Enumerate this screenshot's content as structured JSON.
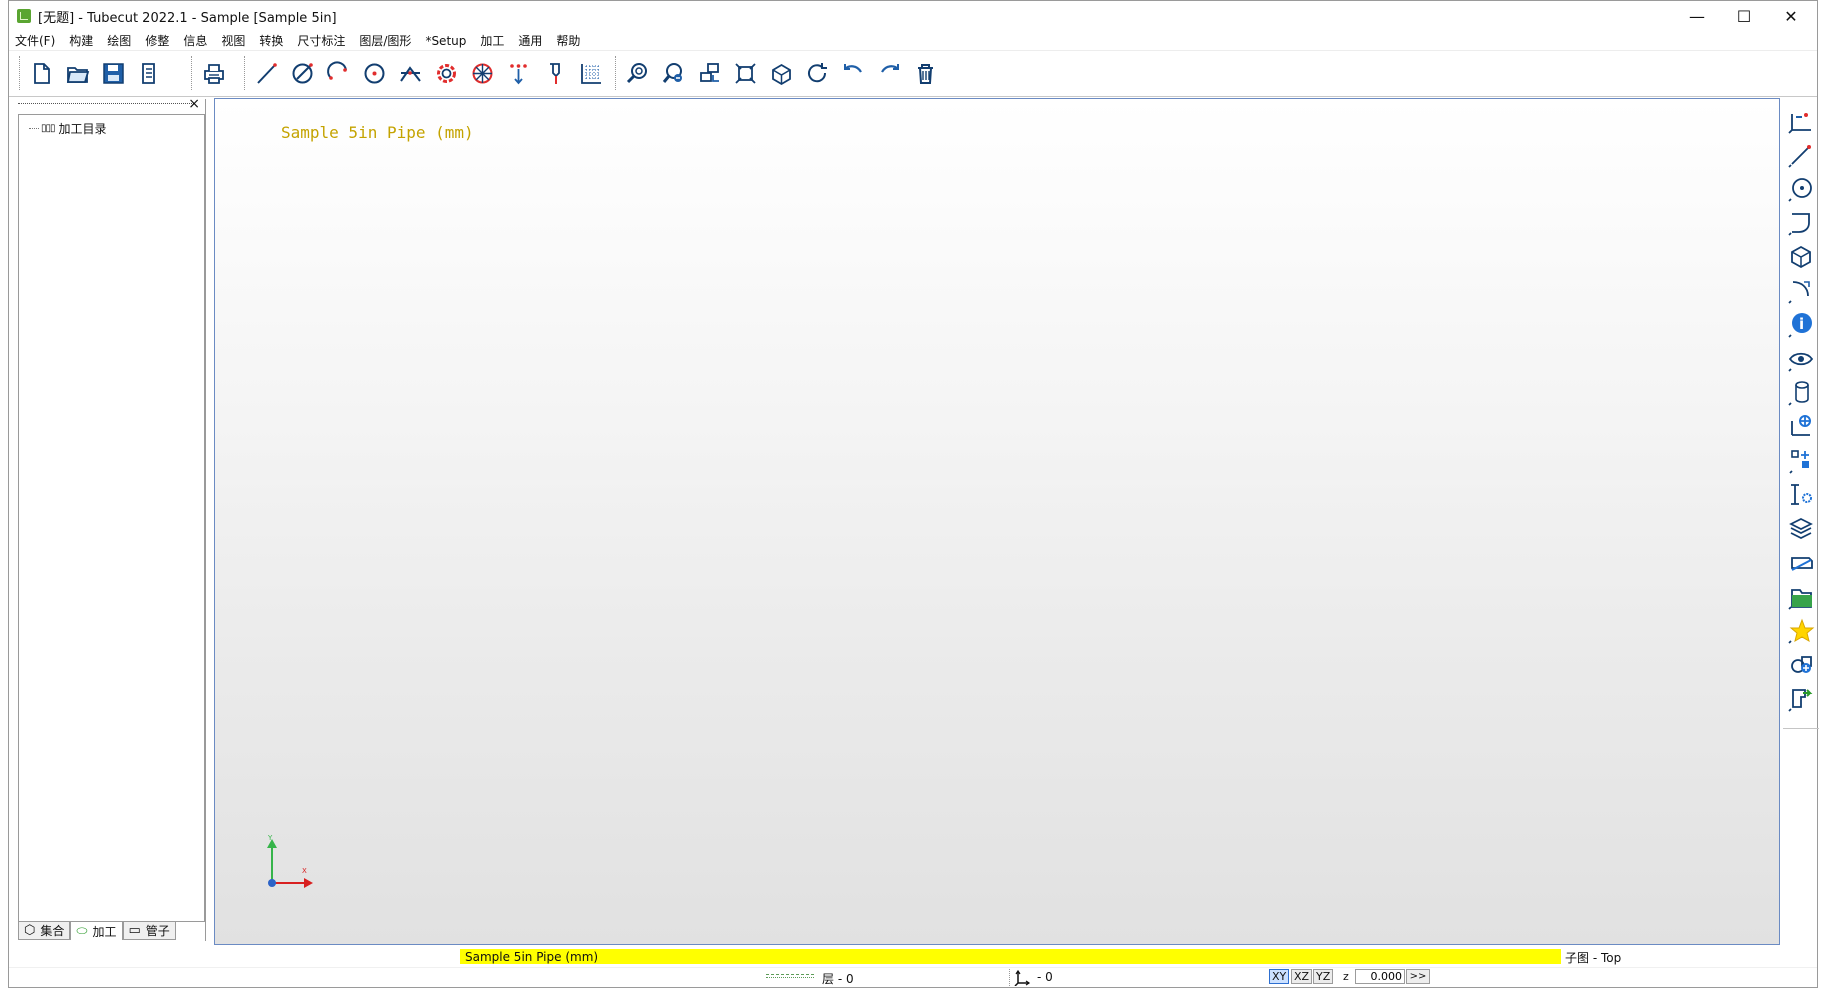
{
  "window": {
    "title": "[无题] - Tubecut 2022.1 - Sample [Sample 5in]",
    "controls": {
      "minimize": "—",
      "maximize": "☐",
      "close": "✕"
    }
  },
  "menu": [
    "文件(F)",
    "构建",
    "绘图",
    "修整",
    "信息",
    "视图",
    "转换",
    "尺寸标注",
    "图层/图形",
    "*Setup",
    "加工",
    "通用",
    "帮助"
  ],
  "toolbar": {
    "icons": [
      "new-file-icon",
      "open-folder-icon",
      "save-icon",
      "document-list-icon",
      "print-icon",
      "line-icon",
      "circle-slash-icon",
      "arc-icon",
      "circle-center-icon",
      "trim-icon",
      "gear-circle-icon",
      "network-icon",
      "array-icon",
      "toolpath-icon",
      "grid-icon",
      "zoom-in-icon",
      "zoom-tool-icon",
      "move-view-icon",
      "fit-view-icon",
      "cube-view-icon",
      "refresh-icon",
      "undo-icon",
      "redo-icon",
      "delete-icon"
    ]
  },
  "left_panel": {
    "close_label": "×",
    "tree": {
      "item": "加工目录"
    },
    "tabs": [
      {
        "icon": "cube-tab-icon",
        "label": "集合"
      },
      {
        "icon": "pipe-tab-icon",
        "label": "加工"
      },
      {
        "icon": "tube-tab-icon",
        "label": "管子"
      }
    ]
  },
  "drawing": {
    "title": "Sample 5in Pipe (mm)",
    "axis": {
      "x_label": "X",
      "y_label": "Y"
    }
  },
  "right_toolbar": {
    "icons": [
      "coordinate-point-icon",
      "line-measure-icon",
      "circle-measure-icon",
      "corner-icon",
      "cube-icon",
      "arc-measure-icon",
      "info-icon",
      "eye-icon",
      "cylinder-icon",
      "target-icon",
      "align-icon",
      "dimension-gear-icon",
      "layers-icon",
      "tag-icon",
      "folder-icon",
      "star-icon",
      "shape-add-icon",
      "export-icon"
    ]
  },
  "status": {
    "main_text": "Sample 5in Pipe (mm)",
    "subview": "子图 - Top",
    "layer": "层 - 0",
    "coord": "- 0",
    "planes": [
      "XY",
      "XZ",
      "YZ"
    ],
    "z_label": "z",
    "z_value": "0.000",
    "next": ">>"
  },
  "colors": {
    "title_text": "#c4a300",
    "status_highlight": "#ffff00",
    "accent": "#1f5fa8",
    "axis_x": "#d82020",
    "axis_y": "#36b44a"
  }
}
